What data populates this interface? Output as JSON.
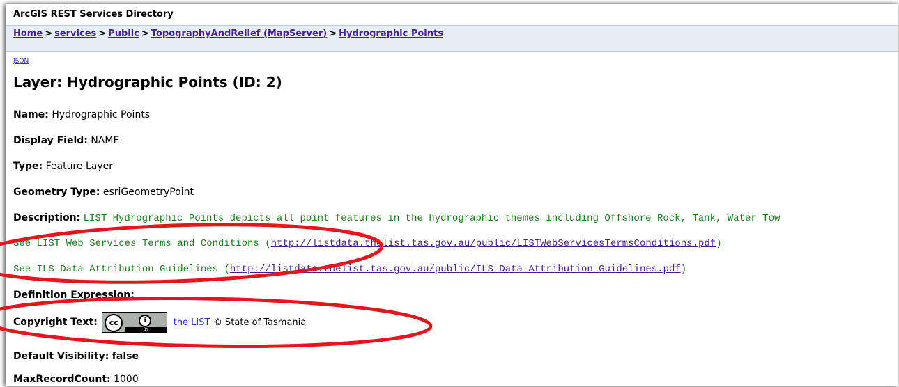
{
  "header": {
    "title": "ArcGIS REST Services Directory"
  },
  "breadcrumb": {
    "items": [
      "Home",
      "services",
      "Public",
      "TopographyAndRelief (MapServer)",
      "Hydrographic Points"
    ],
    "separator": ">"
  },
  "json_link": "JSON",
  "layer": {
    "heading": "Layer: Hydrographic Points (ID: 2)",
    "name_label": "Name:",
    "name_value": "Hydrographic Points",
    "display_label": "Display Field:",
    "display_value": "NAME",
    "type_label": "Type:",
    "type_value": "Feature Layer",
    "geometry_label": "Geometry Type:",
    "geometry_value": "esriGeometryPoint",
    "description_label": "Description:",
    "description_text": "LIST Hydrographic Points depicts all point features in the hydrographic themes including Offshore Rock, Tank, Water Tow",
    "terms_prefix": "See LIST Web Services Terms and Conditions (",
    "terms_url": "http://listdata.thelist.tas.gov.au/public/LISTWebServicesTermsConditions.pdf",
    "terms_suffix": ")",
    "ils_prefix": "See ILS Data Attribution Guidelines (",
    "ils_url": "http://listdata.thelist.tas.gov.au/public/ILS_Data_Attribution_Guidelines.pdf",
    "ils_suffix": ")",
    "definition_label": "Definition Expression:",
    "copyright_label": "Copyright Text:",
    "copyright_badge": {
      "logo": "cc",
      "icon": "person-icon",
      "badge_text": "BY"
    },
    "copyright_link": "the LIST",
    "copyright_suffix": "© State of Tasmania",
    "visibility_label": "Default Visibility:",
    "visibility_value": "false",
    "maxrecord_label": "MaxRecordCount:",
    "maxrecord_value": "1000"
  },
  "colors": {
    "annotation": "#e8131b",
    "breadcrumb_bg": "#e6eef5",
    "description_text": "#1f7a1f",
    "link": "#551a8b"
  }
}
